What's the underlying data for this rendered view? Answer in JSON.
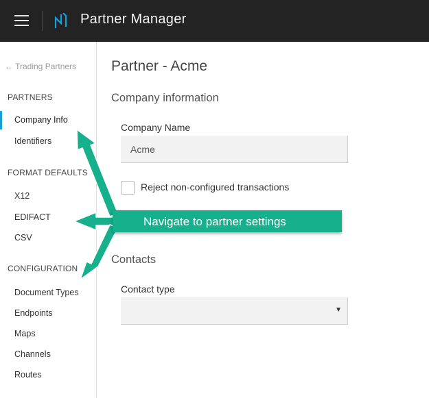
{
  "header": {
    "title": "Partner Manager",
    "menu_icon": "hamburger-menu-icon",
    "logo_icon": "app-logo-icon"
  },
  "sidebar": {
    "back_link": "← Trading Partners",
    "sections": {
      "partners": "PARTNERS",
      "format_defaults": "FORMAT DEFAULTS",
      "configuration": "CONFIGURATION"
    },
    "items": {
      "company_info": "Company Info",
      "identifiers": "Identifiers",
      "x12": "X12",
      "edifact": "EDIFACT",
      "csv": "CSV",
      "document_types": "Document Types",
      "endpoints": "Endpoints",
      "maps": "Maps",
      "channels": "Channels",
      "routes": "Routes"
    },
    "active_item": "Company Info"
  },
  "main": {
    "page_title": "Partner - Acme",
    "company_section": "Company information",
    "company_name_label": "Company Name",
    "company_name_value": "Acme",
    "reject_label": "Reject non-configured transactions",
    "reject_checked": false,
    "contacts_section": "Contacts",
    "contact_type_label": "Contact type",
    "contact_type_value": ""
  },
  "annotation": {
    "text": "Navigate to partner settings"
  },
  "colors": {
    "topbar": "#232323",
    "accent": "#1a9ed9",
    "callout": "#17b08c"
  }
}
